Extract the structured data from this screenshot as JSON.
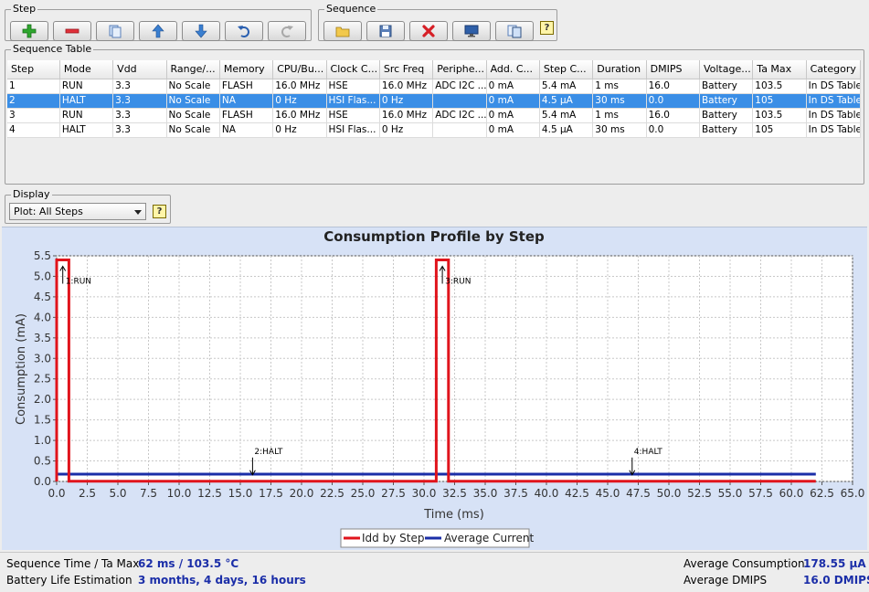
{
  "step_group": {
    "label": "Step"
  },
  "sequence_group": {
    "label": "Sequence"
  },
  "help_label": "?",
  "table_group": {
    "label": "Sequence Table"
  },
  "table": {
    "columns": [
      "Step",
      "Mode",
      "Vdd",
      "Range/...",
      "Memory",
      "CPU/Bu...",
      "Clock C...",
      "Src Freq",
      "Periphe...",
      "Add. C...",
      "Step C...",
      "Duration",
      "DMIPS",
      "Voltage...",
      "Ta Max",
      "Category"
    ],
    "rows": [
      [
        "1",
        "RUN",
        "3.3",
        "No Scale",
        "FLASH",
        "16.0 MHz",
        "HSE",
        "16.0 MHz",
        "ADC I2C ...",
        "0 mA",
        "5.4 mA",
        "1 ms",
        "16.0",
        "Battery",
        "103.5",
        "In DS Table"
      ],
      [
        "2",
        "HALT",
        "3.3",
        "No Scale",
        "NA",
        "0 Hz",
        "HSI Flas...",
        "0 Hz",
        "",
        "0 mA",
        "4.5 µA",
        "30 ms",
        "0.0",
        "Battery",
        "105",
        "In DS Table"
      ],
      [
        "3",
        "RUN",
        "3.3",
        "No Scale",
        "FLASH",
        "16.0 MHz",
        "HSE",
        "16.0 MHz",
        "ADC I2C ...",
        "0 mA",
        "5.4 mA",
        "1 ms",
        "16.0",
        "Battery",
        "103.5",
        "In DS Table"
      ],
      [
        "4",
        "HALT",
        "3.3",
        "No Scale",
        "NA",
        "0 Hz",
        "HSI Flas...",
        "0 Hz",
        "",
        "0 mA",
        "4.5 µA",
        "30 ms",
        "0.0",
        "Battery",
        "105",
        "In DS Table"
      ]
    ],
    "selected_row": 1
  },
  "display_group": {
    "label": "Display",
    "plot_select": "Plot: All Steps"
  },
  "chart_data": {
    "type": "line",
    "title": "Consumption Profile by Step",
    "xlabel": "Time (ms)",
    "ylabel": "Consumption (mA)",
    "xlim": [
      0,
      65
    ],
    "ylim": [
      0,
      5.5
    ],
    "x_ticks": [
      "0.0",
      "2.5",
      "5.0",
      "7.5",
      "10.0",
      "12.5",
      "15.0",
      "17.5",
      "20.0",
      "22.5",
      "25.0",
      "27.5",
      "30.0",
      "32.5",
      "35.0",
      "37.5",
      "40.0",
      "42.5",
      "45.0",
      "47.5",
      "50.0",
      "52.5",
      "55.0",
      "57.5",
      "60.0",
      "62.5",
      "65.0"
    ],
    "y_ticks": [
      "0.0",
      "0.5",
      "1.0",
      "1.5",
      "2.0",
      "2.5",
      "3.0",
      "3.5",
      "4.0",
      "4.5",
      "5.0",
      "5.5"
    ],
    "grid": true,
    "legend_position": "bottom",
    "series": [
      {
        "name": "Idd by Step",
        "color": "#e0141c",
        "x": [
          0,
          0,
          1,
          1,
          31,
          31,
          32,
          32,
          62
        ],
        "y": [
          0,
          5.4,
          5.4,
          0.0045,
          0.0045,
          5.4,
          5.4,
          0.0045,
          0.0045
        ]
      },
      {
        "name": "Average Current",
        "color": "#1b2ea8",
        "x": [
          0,
          62
        ],
        "y": [
          0.17855,
          0.17855
        ]
      }
    ],
    "annotations": [
      {
        "text": "1:RUN",
        "x": 0.5,
        "y": 5.4,
        "direction": "up"
      },
      {
        "text": "2:HALT",
        "x": 16,
        "y": 0.0045,
        "direction": "down"
      },
      {
        "text": "3:RUN",
        "x": 31.5,
        "y": 5.4,
        "direction": "up"
      },
      {
        "text": "4:HALT",
        "x": 47,
        "y": 0.0045,
        "direction": "down"
      }
    ]
  },
  "status": {
    "seq_time_label": "Sequence Time / Ta Max",
    "seq_time_value": "62 ms / 103.5 °C",
    "battery_label": "Battery Life Estimation",
    "battery_value": "3 months, 4 days, 16 hours",
    "avg_consumption_label": "Average Consumption",
    "avg_consumption_value": "178.55 µA",
    "avg_dmips_label": "Average DMIPS",
    "avg_dmips_value": "16.0 DMIPS"
  },
  "colors": {
    "selected_row": "#3a8ee6",
    "chart_bg": "#d7e2f6",
    "accent_value": "#1b2ea8"
  }
}
